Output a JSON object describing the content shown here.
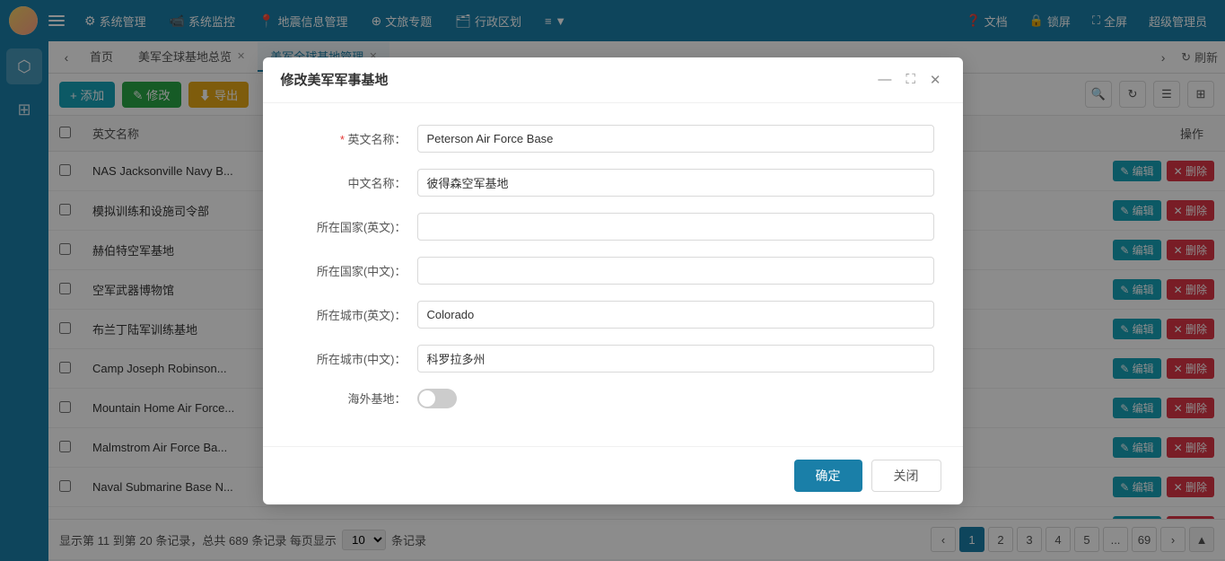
{
  "app": {
    "title": "超级管理员"
  },
  "topnav": {
    "hamburger_label": "☰",
    "items": [
      {
        "id": "system-mgmt",
        "icon": "⚙",
        "label": "系统管理"
      },
      {
        "id": "system-monitor",
        "icon": "📹",
        "label": "系统监控"
      },
      {
        "id": "geo-info",
        "icon": "📍",
        "label": "地震信息管理"
      },
      {
        "id": "culture-tour",
        "icon": "⊕",
        "label": "文旅专题"
      },
      {
        "id": "admin-division",
        "icon": "🗂",
        "label": "行政区划"
      },
      {
        "id": "more",
        "icon": "≡",
        "label": "▼"
      }
    ],
    "right_items": [
      {
        "id": "docs",
        "icon": "❓",
        "label": "文档"
      },
      {
        "id": "lock",
        "icon": "🔒",
        "label": "锁屏"
      },
      {
        "id": "fullscreen",
        "icon": "⛶",
        "label": "全屏"
      }
    ]
  },
  "tabs": {
    "items": [
      {
        "id": "home",
        "label": "首页",
        "closable": false
      },
      {
        "id": "global-bases",
        "label": "美军全球基地总览",
        "closable": true
      },
      {
        "id": "global-bases-mgmt",
        "label": "美军全球基地管理",
        "closable": true,
        "active": true
      }
    ],
    "refresh_label": "刷新"
  },
  "toolbar": {
    "add_label": "+ 添加",
    "edit_label": "✎ 修改",
    "export_label": "⬇ 导出"
  },
  "table": {
    "columns": [
      {
        "id": "checkbox",
        "label": ""
      },
      {
        "id": "name_en",
        "label": "英文名称"
      },
      {
        "id": "actions",
        "label": "操作"
      }
    ],
    "rows": [
      {
        "id": 1,
        "name": "NAS Jacksonville Navy B..."
      },
      {
        "id": 2,
        "name": "模拟训练和设施司令部"
      },
      {
        "id": 3,
        "name": "赫伯特空军基地"
      },
      {
        "id": 4,
        "name": "空军武器博物馆"
      },
      {
        "id": 5,
        "name": "布兰丁陆军训练基地"
      },
      {
        "id": 6,
        "name": "Camp Joseph Robinson..."
      },
      {
        "id": 7,
        "name": "Mountain Home Air Force..."
      },
      {
        "id": 8,
        "name": "Malmstrom Air Force Ba..."
      },
      {
        "id": 9,
        "name": "Naval Submarine Base N..."
      },
      {
        "id": 10,
        "name": "Peterson Air Force Base..."
      }
    ],
    "action_edit": "✎ 编辑",
    "action_delete": "✕ 删除"
  },
  "pagination": {
    "info": "显示第 11 到第 20 条记录，总共 689 条记录 每页显示",
    "page_size": "10",
    "page_size_suffix": "条记录",
    "pages": [
      "‹",
      "1",
      "2",
      "3",
      "4",
      "5",
      "...",
      "69",
      "›"
    ],
    "current_page": "1"
  },
  "modal": {
    "title": "修改美军军事基地",
    "fields": {
      "name_en_label": "英文名称：",
      "name_en_value": "Peterson Air Force Base",
      "name_cn_label": "中文名称：",
      "name_cn_value": "彼得森空军基地",
      "country_en_label": "所在国家(英文)：",
      "country_en_value": "",
      "country_cn_label": "所在国家(中文)：",
      "country_cn_value": "",
      "city_en_label": "所在城市(英文)：",
      "city_en_value": "Colorado",
      "city_cn_label": "所在城市(中文)：",
      "city_cn_value": "科罗拉多州",
      "overseas_label": "海外基地：",
      "overseas_toggle": false
    },
    "btn_confirm": "确定",
    "btn_close": "关闭"
  },
  "sidebar": {
    "items": [
      {
        "id": "home",
        "icon": "⬡",
        "active": true
      },
      {
        "id": "grid",
        "icon": "⊞"
      }
    ]
  }
}
